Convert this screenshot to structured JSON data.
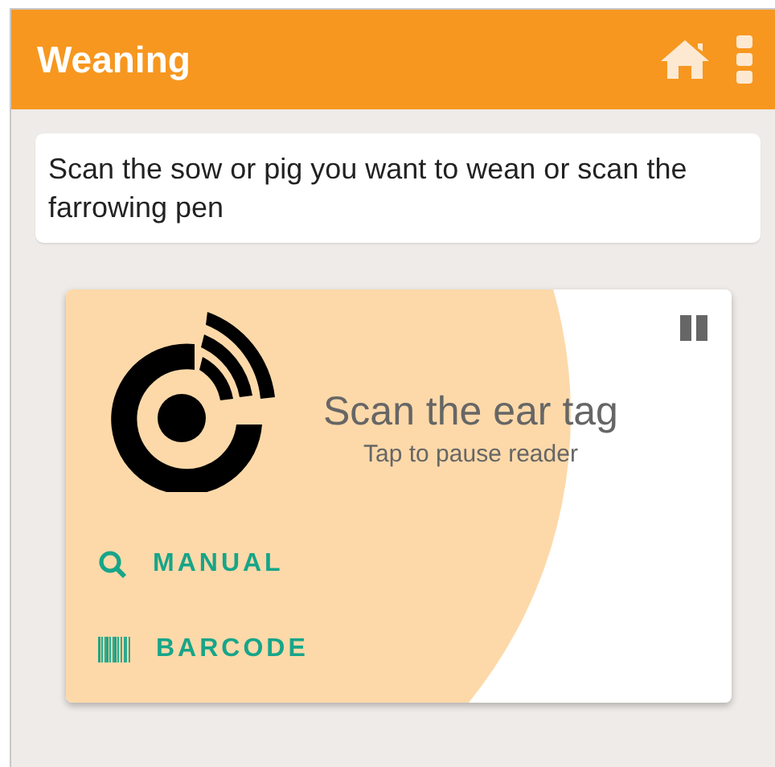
{
  "app_bar": {
    "title": "Weaning"
  },
  "instruction": "Scan the sow or pig you want to wean or scan the farrowing pen",
  "reader": {
    "title": "Scan the ear tag",
    "hint": "Tap to pause reader"
  },
  "actions": [
    {
      "kind": "search",
      "label": "MANUAL"
    },
    {
      "kind": "barcode",
      "label": "BARCODE"
    }
  ]
}
